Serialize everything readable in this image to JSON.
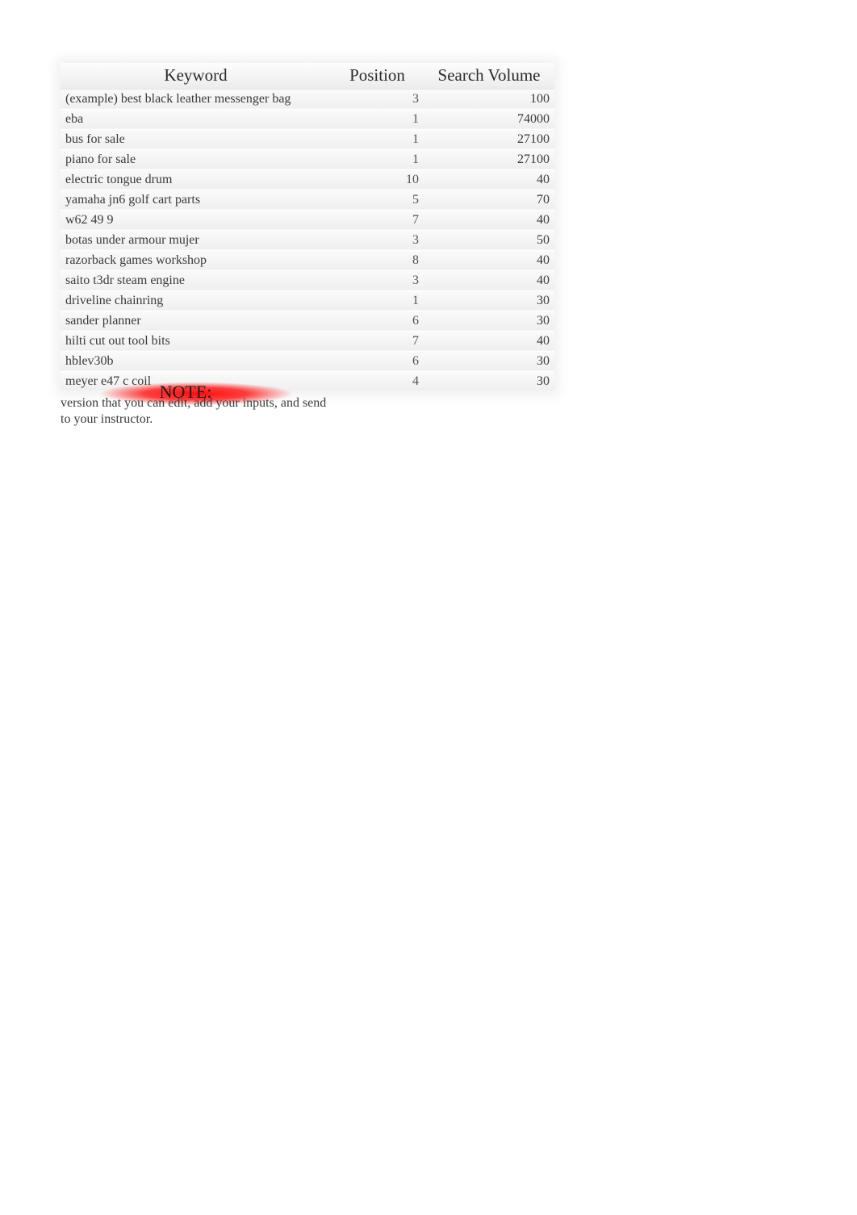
{
  "table": {
    "headers": {
      "keyword": "Keyword",
      "position": "Position",
      "volume": "Search Volume"
    },
    "rows": [
      {
        "keyword": "(example) best black leather messenger bag",
        "position": "3",
        "volume": "100"
      },
      {
        "keyword": "eba",
        "position": "1",
        "volume": "74000"
      },
      {
        "keyword": "bus for sale",
        "position": "1",
        "volume": "27100"
      },
      {
        "keyword": "piano for sale",
        "position": "1",
        "volume": "27100"
      },
      {
        "keyword": "electric tongue drum",
        "position": "10",
        "volume": "40"
      },
      {
        "keyword": "yamaha jn6 golf cart parts",
        "position": "5",
        "volume": "70"
      },
      {
        "keyword": "w62 49 9",
        "position": "7",
        "volume": "40"
      },
      {
        "keyword": "botas under armour mujer",
        "position": "3",
        "volume": "50"
      },
      {
        "keyword": "razorback games workshop",
        "position": "8",
        "volume": "40"
      },
      {
        "keyword": "saito t3dr steam engine",
        "position": "3",
        "volume": "40"
      },
      {
        "keyword": "driveline chainring",
        "position": "1",
        "volume": "30"
      },
      {
        "keyword": "sander planner",
        "position": "6",
        "volume": "30"
      },
      {
        "keyword": "hilti cut out tool bits",
        "position": "7",
        "volume": "40"
      },
      {
        "keyword": "hblev30b",
        "position": "6",
        "volume": "30"
      },
      {
        "keyword": "meyer e47 c coil",
        "position": "4",
        "volume": "30"
      }
    ]
  },
  "note": {
    "title": "NOTE:",
    "text": "version that you can edit, add your inputs, and send to your instructor."
  }
}
